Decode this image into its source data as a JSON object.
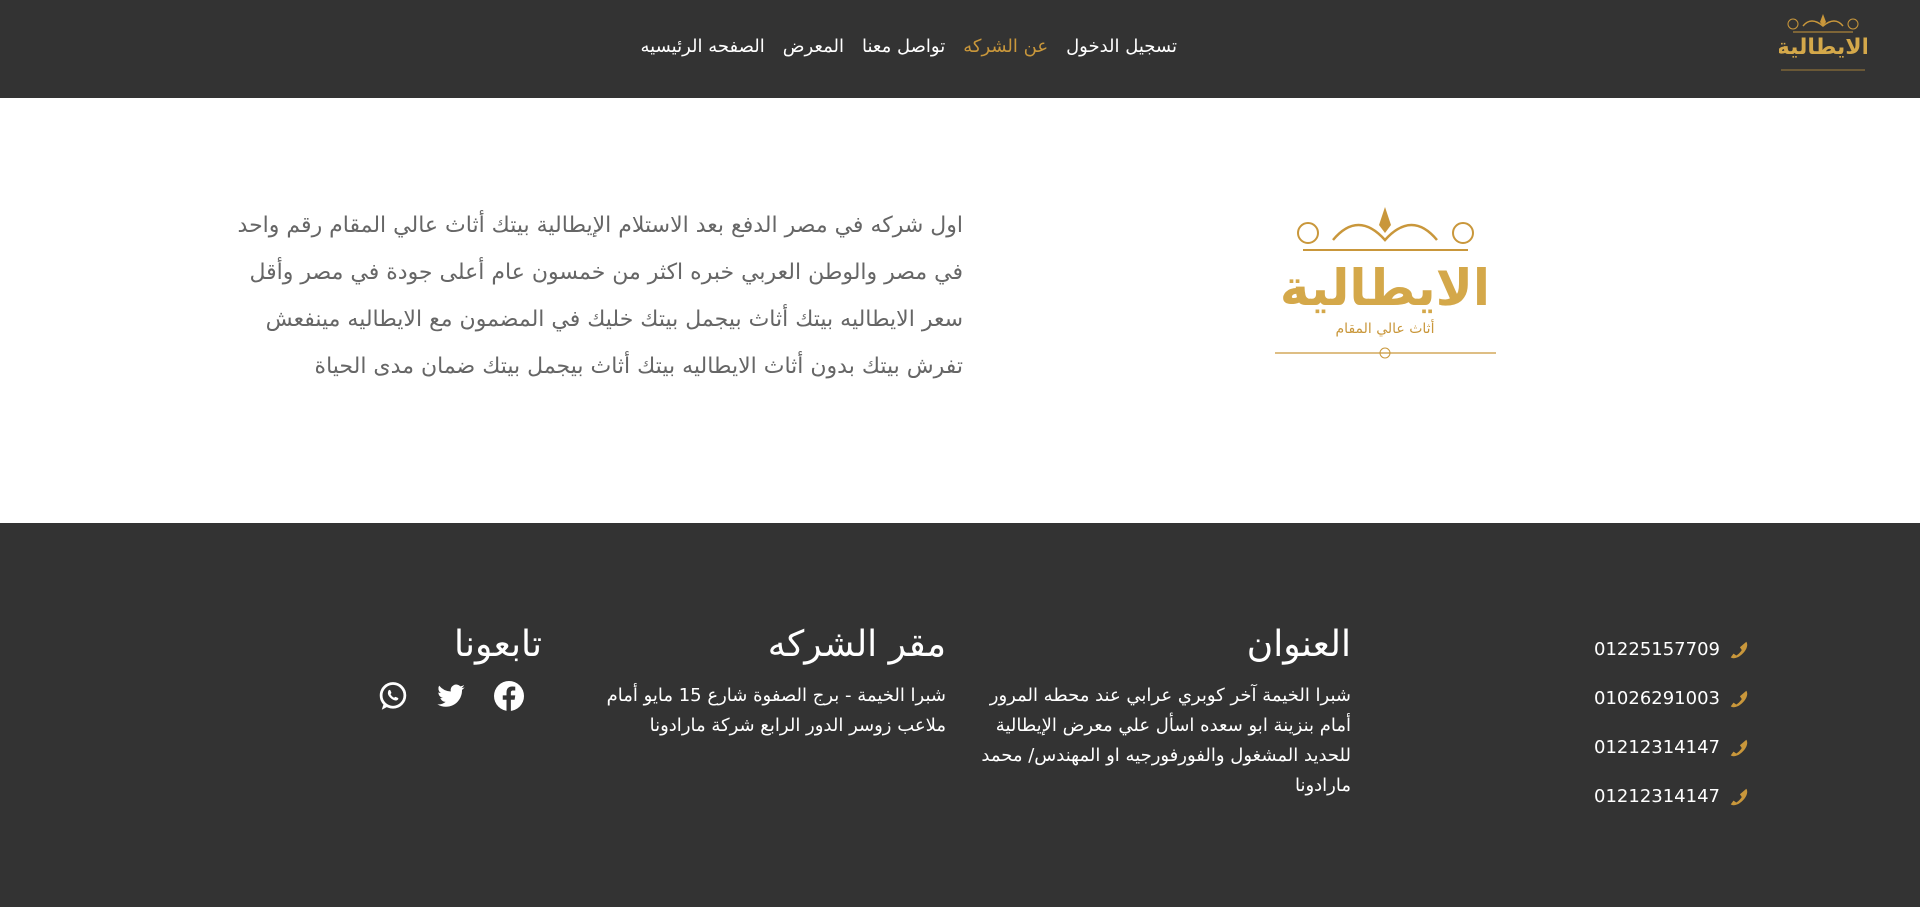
{
  "brand": {
    "logo_text": "الايطالية",
    "logo_tagline": "أثاث عالي المقام",
    "gold": "#c9973b"
  },
  "nav": {
    "items": [
      {
        "label": "الصفحه الرئيسيه"
      },
      {
        "label": "المعرض"
      },
      {
        "label": "تواصل معنا"
      },
      {
        "label": "عن الشركه",
        "active": true
      },
      {
        "label": "تسجيل الدخول"
      }
    ]
  },
  "about": {
    "text": "اول شركه في مصر الدفع بعد الاستلام الإيطالية بيتك أثاث عالي المقام رقم واحد في مصر والوطن العربي خبره اكثر من خمسون عام أعلى جودة في مصر وأقل سعر الايطاليه بيتك أثاث بيجمل بيتك خليك في المضمون مع الايطاليه مينفعش تفرش بيتك بدون أثاث الايطاليه بيتك أثاث بيجمل بيتك ضمان مدى الحياة"
  },
  "footer": {
    "phones": [
      "01225157709",
      "01026291003",
      "01212314147",
      "01212314147"
    ],
    "address": {
      "title": "العنوان",
      "text": "شبرا الخيمة آخر كوبري عرابي عند محطه المرور أمام بنزينة ابو سعده اسأل علي معرض الإيطالية للحديد المشغول والفورفورجيه او المهندس/ محمد مارادونا"
    },
    "hq": {
      "title": "مقر الشركه",
      "text": "شبرا الخيمة - برج الصفوة شارع 15 مايو أمام ملاعب زوسر الدور الرابع شركة مارادونا"
    },
    "follow": {
      "title": "تابعونا",
      "icons": [
        "facebook-icon",
        "twitter-icon",
        "whatsapp-icon"
      ]
    }
  }
}
